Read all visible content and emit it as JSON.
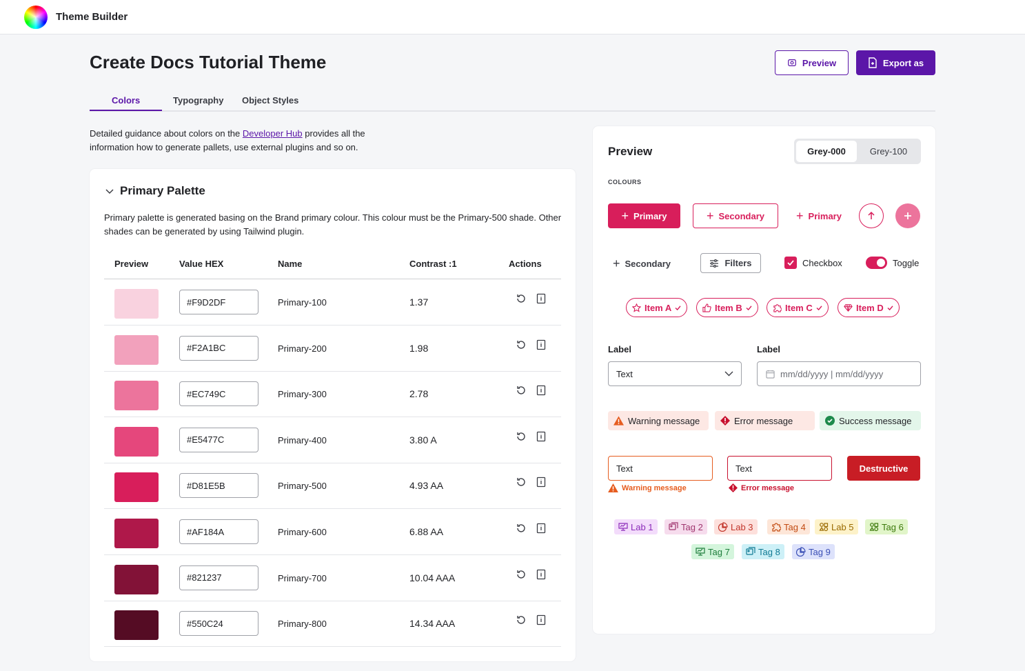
{
  "app": {
    "title": "Theme Builder"
  },
  "page": {
    "title": "Create Docs Tutorial Theme",
    "preview_button": "Preview",
    "export_button": "Export as"
  },
  "tabs": [
    "Colors",
    "Typography",
    "Object Styles"
  ],
  "intro": {
    "before": "Detailed guidance about colors on the ",
    "link": "Developer Hub",
    "after": " provides all the information how to generate pallets, use external plugins and so on."
  },
  "palette": {
    "title": "Primary Palette",
    "description": "Primary palette is generated basing on the Brand primary colour. This colour must be the Primary-500 shade. Other shades can be generated by using Tailwind plugin.",
    "columns": [
      "Preview",
      "Value HEX",
      "Name",
      "Contrast :1",
      "Actions"
    ],
    "rows": [
      {
        "color": "#F9D2DF",
        "hex": "#F9D2DF",
        "name": "Primary-100",
        "contrast": "1.37"
      },
      {
        "color": "#F2A1BC",
        "hex": "#F2A1BC",
        "name": "Primary-200",
        "contrast": "1.98"
      },
      {
        "color": "#EC749C",
        "hex": "#EC749C",
        "name": "Primary-300",
        "contrast": "2.78"
      },
      {
        "color": "#E5477C",
        "hex": "#E5477C",
        "name": "Primary-400",
        "contrast": "3.80 A"
      },
      {
        "color": "#D81E5B",
        "hex": "#D81E5B",
        "name": "Primary-500",
        "contrast": "4.93 AA"
      },
      {
        "color": "#AF184A",
        "hex": "#AF184A",
        "name": "Primary-600",
        "contrast": "6.88 AA"
      },
      {
        "color": "#821237",
        "hex": "#821237",
        "name": "Primary-700",
        "contrast": "10.04 AAA"
      },
      {
        "color": "#550C24",
        "hex": "#550C24",
        "name": "Primary-800",
        "contrast": "14.34 AAA"
      }
    ]
  },
  "preview": {
    "title": "Preview",
    "segments": [
      "Grey-000",
      "Grey-100"
    ],
    "selected_segment": "Grey-000",
    "section_label": "COLOURS",
    "buttons": {
      "primary": "Primary",
      "secondary": "Secondary",
      "text_primary": "Primary",
      "text_secondary": "Secondary",
      "filters": "Filters",
      "checkbox": "Checkbox",
      "toggle": "Toggle"
    },
    "chips": [
      "Item A",
      "Item B",
      "Item C",
      "Item D"
    ],
    "select": {
      "label": "Label",
      "value": "Text"
    },
    "date": {
      "label": "Label",
      "placeholder": "mm/dd/yyyy | mm/dd/yyyy"
    },
    "messages": {
      "warning": "Warning message",
      "error": "Error message",
      "success": "Success message"
    },
    "inputs": {
      "warn_value": "Text",
      "warn_hint": "Warning message",
      "err_value": "Text",
      "err_hint": "Error message",
      "destructive": "Destructive"
    },
    "tags": [
      {
        "label": "Lab 1",
        "bg": "#f3dcfb",
        "fg": "#8b2bb9",
        "icon": "presentation-icon"
      },
      {
        "label": "Tag 2",
        "bg": "#f6dced",
        "fg": "#a0366f",
        "icon": "images-icon"
      },
      {
        "label": "Lab 3",
        "bg": "#fde0dc",
        "fg": "#c2352a",
        "icon": "pie-chart-icon"
      },
      {
        "label": "Tag 4",
        "bg": "#fde6d8",
        "fg": "#c24b12",
        "icon": "puzzle-icon"
      },
      {
        "label": "Lab 5",
        "bg": "#fdf2c9",
        "fg": "#9a6a00",
        "icon": "shapes-icon"
      },
      {
        "label": "Tag 6",
        "bg": "#e1f5c9",
        "fg": "#3d7a0c",
        "icon": "shapes-icon"
      },
      {
        "label": "Tag 7",
        "bg": "#d4f5dc",
        "fg": "#1e7d3c",
        "icon": "presentation-icon"
      },
      {
        "label": "Tag 8",
        "bg": "#cdf0f7",
        "fg": "#107a94",
        "icon": "images-icon"
      },
      {
        "label": "Tag 9",
        "bg": "#dde2fb",
        "fg": "#3a4fb5",
        "icon": "pie-chart-icon"
      }
    ]
  },
  "colors": {
    "accent": "#5B16A8",
    "primary": "#D81E5B",
    "destructive": "#C81D25",
    "warning": "#E65C1F",
    "success": "#1E8A4C"
  }
}
